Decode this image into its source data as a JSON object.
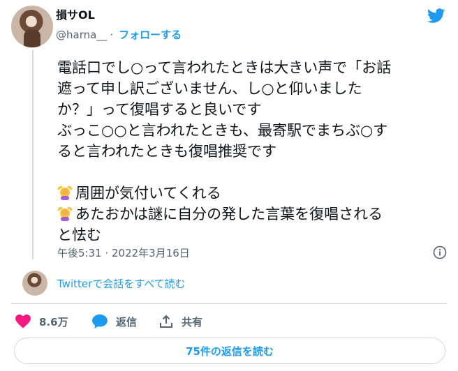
{
  "author": {
    "name": "損サOL",
    "handle": "@harna__",
    "follow_label": "フォローする"
  },
  "tweet": {
    "lines": [
      "電話口でし○って言われたときは大きい声で「お話",
      "遮って申し訳ございません、し○と仰いました",
      "か？」って復唱すると良いです",
      "ぶっこ○○と言われたときも、最寄駅でまちぶ○す",
      "ると言われたときも復唱推奨です"
    ],
    "bullet_lines": [
      "周囲が気付いてくれる",
      "あたおかは謎に自分の発した言葉を復唱される",
      "と怯む"
    ],
    "timestamp": "午後5:31 · 2022年3月16日"
  },
  "conversation_link": "Twitterで会話をすべて読む",
  "actions": {
    "likes": "8.6万",
    "reply_label": "返信",
    "share_label": "共有"
  },
  "read_replies_label": "75件の返信を読む",
  "colors": {
    "accent": "#1d9bf0",
    "text": "#0f1419",
    "muted": "#536471",
    "like": "#f91880"
  },
  "icons": {
    "logo": "twitter-bird-icon",
    "emoji": "person-gesturing-ok-emoji",
    "info": "info-icon",
    "like": "heart-icon",
    "reply": "speech-bubble-icon",
    "share": "share-upload-icon"
  }
}
